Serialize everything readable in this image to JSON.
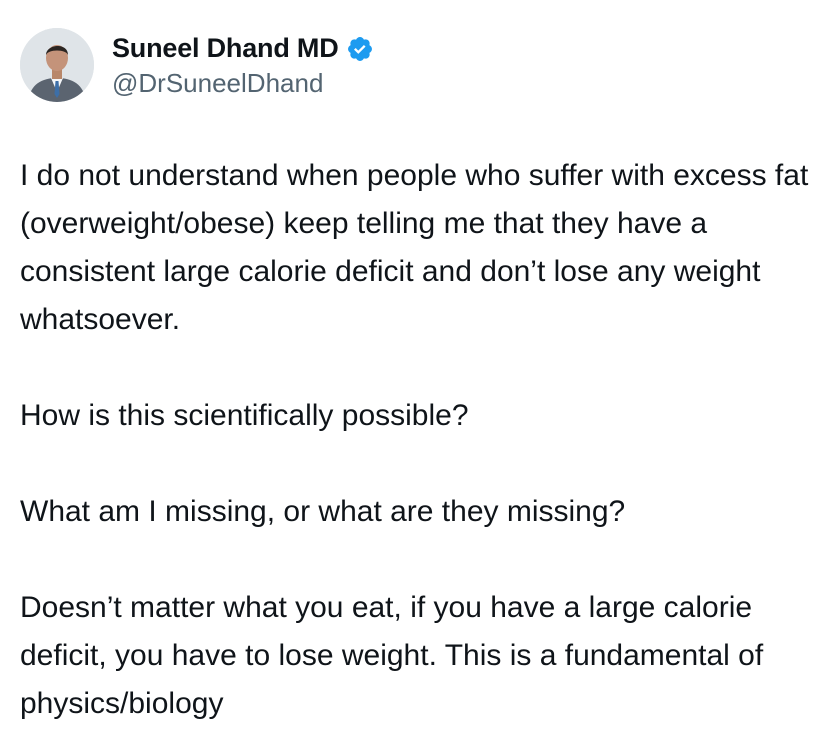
{
  "author": {
    "display_name": "Suneel Dhand MD",
    "handle": "@DrSuneelDhand",
    "verified_icon": "verified-badge-icon",
    "verified_color": "#1d9bf0"
  },
  "tweet": {
    "paragraphs": [
      "I do not understand when people who suffer with excess fat (overweight/obese) keep telling me that they have a consistent large calorie deficit and don’t lose any weight whatsoever.",
      "How is this scientifically possible?",
      "What am I missing, or what are they missing?",
      "Doesn’t matter what you eat, if you have a large calorie deficit, you have to lose weight. This is a fundamental of physics/biology"
    ]
  },
  "colors": {
    "text": "#0f1419",
    "secondary_text": "#536471",
    "background": "#ffffff"
  }
}
